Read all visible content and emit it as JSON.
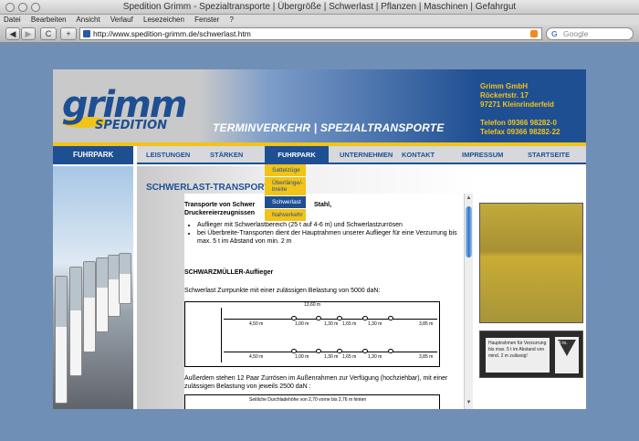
{
  "browser": {
    "window_title": "Spedition Grimm - Spezialtransporte | Übergröße | Schwerlast | Pflanzen | Maschinen | Gefahrgut",
    "menu": [
      "Datei",
      "Bearbeiten",
      "Ansicht",
      "Verlauf",
      "Lesezeichen",
      "Fenster",
      "?"
    ],
    "url": "http://www.spedition-grimm.de/schwerlast.htm",
    "search_placeholder": "Google",
    "back": "◀",
    "forward": "▶",
    "reload": "C",
    "newtab": "+"
  },
  "site": {
    "logo_word": "grimm",
    "logo_sub": "SPEDITION",
    "slogan": "TERMINVERKEHR | SPEZIALTRANSPORTE",
    "address": {
      "company": "Grimm GmbH",
      "street": "Röckertstr. 17",
      "city": "97271 Kleinrinderfeld",
      "phone": "Telefon 09366 98282-0",
      "fax": "Telefax 09366 98282-22"
    },
    "section_label": "FUHRPARK",
    "nav": [
      "LEISTUNGEN",
      "STÄRKEN",
      "FUHRPARK",
      "UNTERNEHMEN",
      "KONTAKT",
      "IMPRESSUM",
      "STARTSEITE"
    ],
    "dropdown": [
      "Sattelzüge",
      "Überlänge/-breite",
      "Schwerlast",
      "Nahverkehr"
    ],
    "page_title": "SCHWERLAST-TRANSPORTE",
    "intro_line1": "Transporte von Schwer",
    "intro_line1b": "Stahl,",
    "intro_line2": "Druckereierzeugnissen",
    "bullet1": "Auflieger mit Schwerlastbereich (25 t auf 4-6 m) und Schwerlastzurrösen",
    "bullet2": "bei Überbreite-Transporten dient der Hauptrahmen unserer Auflieger für eine Verzurrung bis max. 5 t im Abstand von min. 2 m",
    "subhead": "SCHWARZMÜLLER-Auflieger",
    "schwerlast_text": "Schwerlast Zurrpunkte mit einer zulässigen Belastung von 5000 daN:",
    "diagram_total": "13,60 m",
    "diagram_labels": [
      "4,50 m",
      "1,00 m",
      "1,30 m",
      "1,65 m",
      "1,30 m",
      "3,85 m"
    ],
    "outer_text": "Außerdem stehen 12 Paar Zurrösen im Außenrahmen zur Verfügung (hochziehbar), mit einer zulässigen Belastung von jeweils 2500 daN :",
    "small_caption": "Seitliche Durchladehöhe von 2,70 vorne bis 2,76 m hinten",
    "sign_text": "Hauptrahmen für Verzurrung bis max. 5 t im Abstand von mind. 2 m zulässig!",
    "sign_badge": "5 to."
  },
  "colors": {
    "brand_blue": "#1f4f93",
    "brand_yellow": "#f2c318",
    "desktop": "#6f8fb6"
  }
}
